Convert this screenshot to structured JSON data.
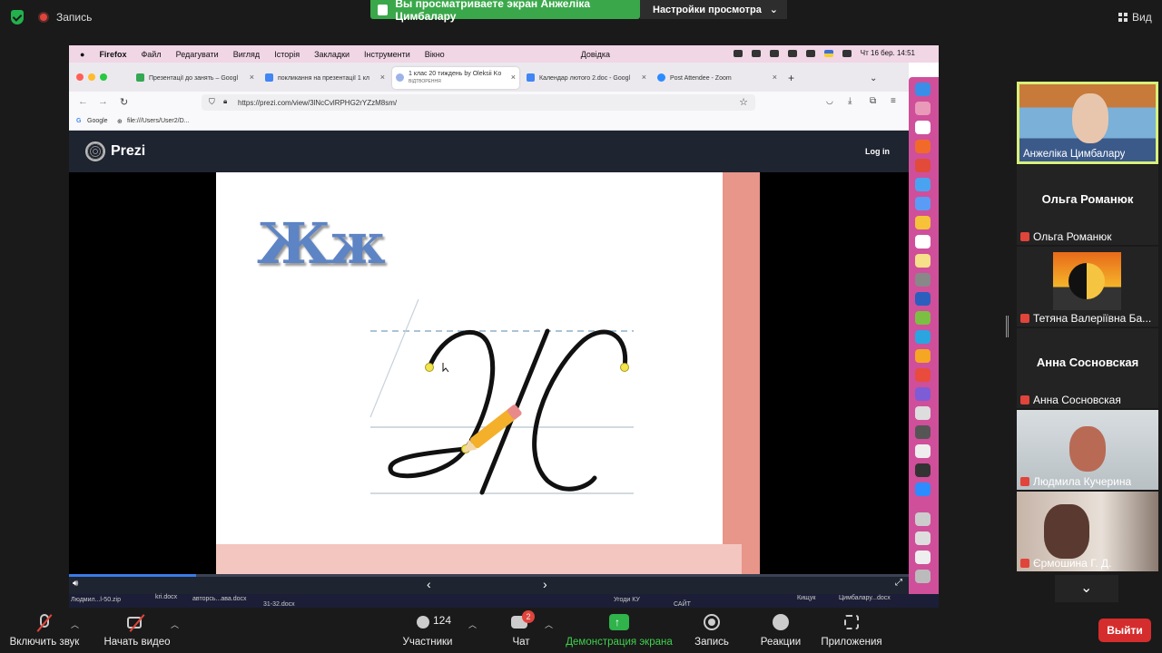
{
  "zoom_top": {
    "recording_label": "Запись",
    "banner_text": "Вы просматриваете экран Анжеліка Цимбалару",
    "view_settings": "Настройки просмотра",
    "view_label": "Вид"
  },
  "mac_menu": {
    "items": [
      "Firefox",
      "Файл",
      "Редагувати",
      "Вигляд",
      "Історія",
      "Закладки",
      "Інструменти",
      "Вікно",
      "Довідка"
    ],
    "clock": "Чт 16 бер.  14:51"
  },
  "browser": {
    "tabs": [
      {
        "label": "Презентації до занять – Googl",
        "color": "#34a853"
      },
      {
        "label": "покликання на презентації 1 кл",
        "color": "#4285f4"
      },
      {
        "label": "1 клас 20 тиждень by Oleksii Ko",
        "sub": "ВІДТВОРЕННЯ",
        "color": "#9db3e8"
      },
      {
        "label": "Календар лютого 2.doc - Googl",
        "color": "#4285f4"
      },
      {
        "label": "Post Attendee - Zoom",
        "color": "#2d8cff"
      }
    ],
    "url": "https://prezi.com/view/3lNcCvlRPHG2rYZzM8sm/",
    "bookmarks": [
      "Google",
      "file:///Users/User2/D..."
    ]
  },
  "prezi": {
    "logo": "Prezi",
    "login": "Log in",
    "slide_heading": "Жж"
  },
  "taskbar": [
    "Людмил...l-50.zip",
    "kri.docx",
    "авторсь...ава.docx",
    "31-32.docx",
    "Угоди КУ",
    "САЙТ",
    "Кищук",
    "Цимбалару...docx"
  ],
  "participants": [
    {
      "name": "Анжеліка Цимбалару",
      "type": "video",
      "active": true
    },
    {
      "name": "Ольга Романюк",
      "type": "name"
    },
    {
      "name": "Тетяна Валеріївна Ба...",
      "type": "avatar"
    },
    {
      "name": "Анна Сосновская",
      "type": "name"
    },
    {
      "name": "Людмила Кучерина",
      "type": "video"
    },
    {
      "name": "Єрмошина Г. Д.",
      "type": "video"
    }
  ],
  "toolbar": {
    "audio": "Включить звук",
    "video": "Начать видео",
    "participants": "Участники",
    "participants_count": "124",
    "chat": "Чат",
    "chat_badge": "2",
    "share": "Демонстрация экрана",
    "record": "Запись",
    "reactions": "Реакции",
    "apps": "Приложения",
    "leave": "Выйти"
  },
  "colors": {
    "share_green": "#3aa84a",
    "leave_red": "#d52d2d",
    "dock_pink": "#cf4f9a",
    "slide_letter": "#5d84c4"
  }
}
